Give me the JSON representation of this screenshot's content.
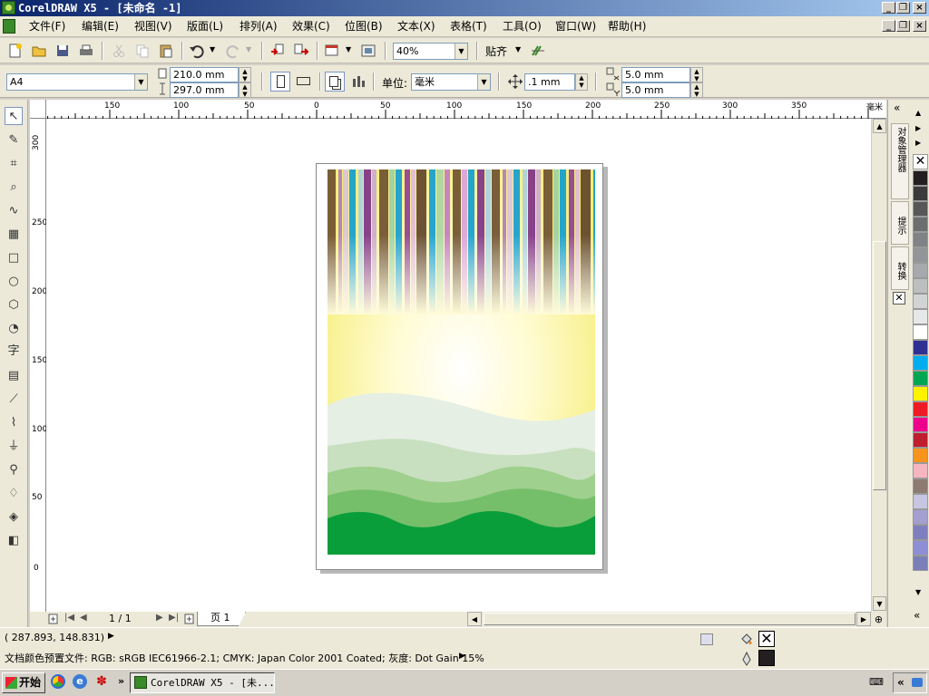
{
  "window": {
    "title": "CorelDRAW X5 - [未命名 -1]"
  },
  "menu": {
    "items": [
      "文件(F)",
      "编辑(E)",
      "视图(V)",
      "版面(L)",
      "排列(A)",
      "效果(C)",
      "位图(B)",
      "文本(X)",
      "表格(T)",
      "工具(O)",
      "窗口(W)",
      "帮助(H)"
    ]
  },
  "toolbar": {
    "zoom": "40%",
    "snap_label": "贴齐"
  },
  "property_bar": {
    "page_size": "A4",
    "width": "210.0 mm",
    "height": "297.0 mm",
    "units_label": "单位:",
    "units_value": "毫米",
    "nudge": ".1 mm",
    "dup_x": "5.0 mm",
    "dup_y": "5.0 mm"
  },
  "rulers": {
    "h_ticks": [
      "150",
      "100",
      "50",
      "0",
      "50",
      "100",
      "150",
      "200",
      "250",
      "300",
      "350"
    ],
    "h_unit": "毫米",
    "v_ticks": [
      "300",
      "250",
      "200",
      "150",
      "100",
      "50",
      "0"
    ]
  },
  "page_nav": {
    "counter": "1 / 1",
    "tab": "页 1"
  },
  "dockers": {
    "tabs": [
      "对象管理器",
      "提示",
      "转换"
    ]
  },
  "palette": {
    "colors": [
      "#231f20",
      "#3a3a3a",
      "#575757",
      "#6d6e70",
      "#808285",
      "#939598",
      "#a7a9ac",
      "#bcbec0",
      "#d1d3d4",
      "#e6e7e8",
      "#ffffff",
      "#2e3192",
      "#00aeef",
      "#00a651",
      "#fff200",
      "#ed1c24",
      "#ec008c",
      "#be1e2d",
      "#f7941d",
      "#f5b6c1",
      "#8c7b70",
      "#c7c5e1",
      "#a3a0d0",
      "#7f7fbf",
      "#8e8ed6",
      "#7b7fb8"
    ]
  },
  "status": {
    "coords": "( 287.893, 148.831)",
    "profile": "文档颜色预置文件: RGB: sRGB IEC61966-2.1; CMYK: Japan Color 2001 Coated; 灰度: Dot Gain 15%"
  },
  "taskbar": {
    "start": "开始",
    "task": "CorelDRAW X5 - [未..."
  }
}
